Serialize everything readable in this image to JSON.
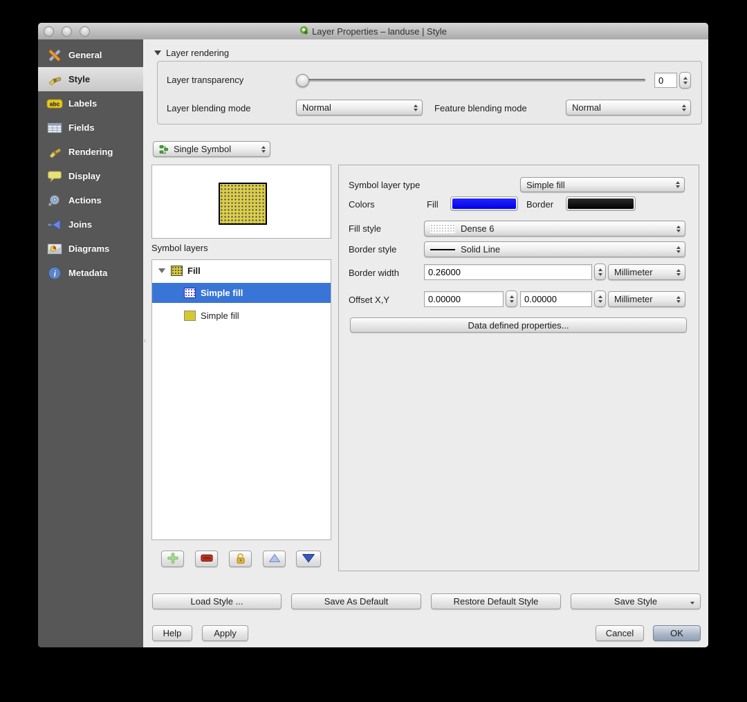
{
  "window": {
    "title": "Layer Properties – landuse | Style"
  },
  "sidebar": {
    "items": [
      {
        "label": "General"
      },
      {
        "label": "Style"
      },
      {
        "label": "Labels"
      },
      {
        "label": "Fields"
      },
      {
        "label": "Rendering"
      },
      {
        "label": "Display"
      },
      {
        "label": "Actions"
      },
      {
        "label": "Joins"
      },
      {
        "label": "Diagrams"
      },
      {
        "label": "Metadata"
      }
    ],
    "selected": "Style"
  },
  "layer_rendering": {
    "title": "Layer rendering",
    "transparency_label": "Layer transparency",
    "transparency_value": "0",
    "layer_blending_label": "Layer blending mode",
    "layer_blending_value": "Normal",
    "feature_blending_label": "Feature blending mode",
    "feature_blending_value": "Normal"
  },
  "renderer": {
    "value": "Single Symbol"
  },
  "symbol_panel": {
    "symbol_layers_label": "Symbol layers",
    "tree": [
      {
        "label": "Fill",
        "swatch": "yellow-dotted",
        "expanded": true
      },
      {
        "label": "Simple fill",
        "swatch": "blue-dotted",
        "selected": true
      },
      {
        "label": "Simple fill",
        "swatch": "yellow-solid"
      }
    ],
    "toolbar": [
      "add",
      "remove",
      "lock",
      "move-up",
      "move-down"
    ]
  },
  "properties": {
    "symbol_layer_type_label": "Symbol layer type",
    "symbol_layer_type_value": "Simple fill",
    "colors_label": "Colors",
    "fill_label": "Fill",
    "border_label": "Border",
    "fill_style_label": "Fill style",
    "fill_style_value": "Dense 6",
    "border_style_label": "Border style",
    "border_style_value": "Solid Line",
    "border_width_label": "Border width",
    "border_width_value": "0.26000",
    "border_width_unit": "Millimeter",
    "offset_label": "Offset X,Y",
    "offset_x_value": "0.00000",
    "offset_y_value": "0.00000",
    "offset_unit": "Millimeter",
    "data_defined_button": "Data defined properties..."
  },
  "style_actions": {
    "load": "Load Style ...",
    "save_default": "Save As Default",
    "restore": "Restore Default Style",
    "save": "Save Style"
  },
  "dialog_actions": {
    "help": "Help",
    "apply": "Apply",
    "cancel": "Cancel",
    "ok": "OK"
  },
  "colors": {
    "selection_blue": "#3875d7",
    "fill_color": "#0000ff",
    "border_color": "#000000",
    "symbol_fill_yellow": "#d9cc3c",
    "sidebar_gray": "#575757"
  }
}
